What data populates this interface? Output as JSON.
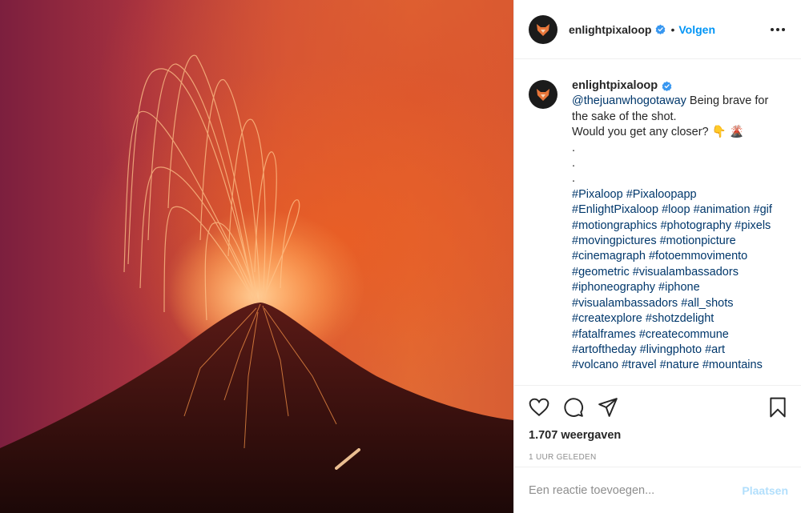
{
  "media": {
    "alt_subject": "volcano-eruption-photo"
  },
  "header": {
    "username": "enlightpixaloop",
    "separator": "•",
    "follow_label": "Volgen"
  },
  "caption": {
    "username": "enlightpixaloop",
    "lines": [
      [
        "@thejuanwhogotaway",
        " Being brave for"
      ],
      [
        "the sake of the shot."
      ],
      [
        "Would you get any closer? 👇 🌋"
      ],
      [
        "."
      ],
      [
        "."
      ],
      [
        "."
      ],
      [
        "#Pixaloop",
        " ",
        "#Pixaloopapp"
      ],
      [
        "#EnlightPixaloop",
        " ",
        "#loop",
        " ",
        "#animation",
        " ",
        "#gif"
      ],
      [
        "#motiongraphics",
        " ",
        "#photography",
        " ",
        "#pixels"
      ],
      [
        "#movingpictures",
        " ",
        "#motionpicture"
      ],
      [
        "#cinemagraph",
        " ",
        "#fotoemmovimento"
      ],
      [
        "#geometric",
        " ",
        "#visualambassadors"
      ],
      [
        "#iphoneography",
        " ",
        "#iphone"
      ],
      [
        "#visualambassadors",
        " ",
        "#all_shots"
      ],
      [
        "#createxplore",
        " ",
        "#shotzdelight"
      ],
      [
        "#fatalframes",
        " ",
        "#createcommune"
      ],
      [
        "#artoftheday",
        " ",
        "#livingphoto",
        " ",
        "#art"
      ],
      [
        "#volcano",
        " ",
        "#travel",
        " ",
        "#nature",
        " ",
        "#mountains"
      ]
    ]
  },
  "stats": {
    "views": "1.707 weergaven",
    "time": "1 uur geleden"
  },
  "comment": {
    "placeholder": "Een reactie toevoegen...",
    "post_label": "Plaatsen"
  },
  "colors": {
    "link": "#00376b",
    "follow": "#0095f6",
    "post_disabled": "#b2dffc",
    "verified": "#3897f0"
  },
  "icons": [
    "more-icon",
    "heart-icon",
    "comment-icon",
    "share-icon",
    "bookmark-icon",
    "verified-icon"
  ]
}
